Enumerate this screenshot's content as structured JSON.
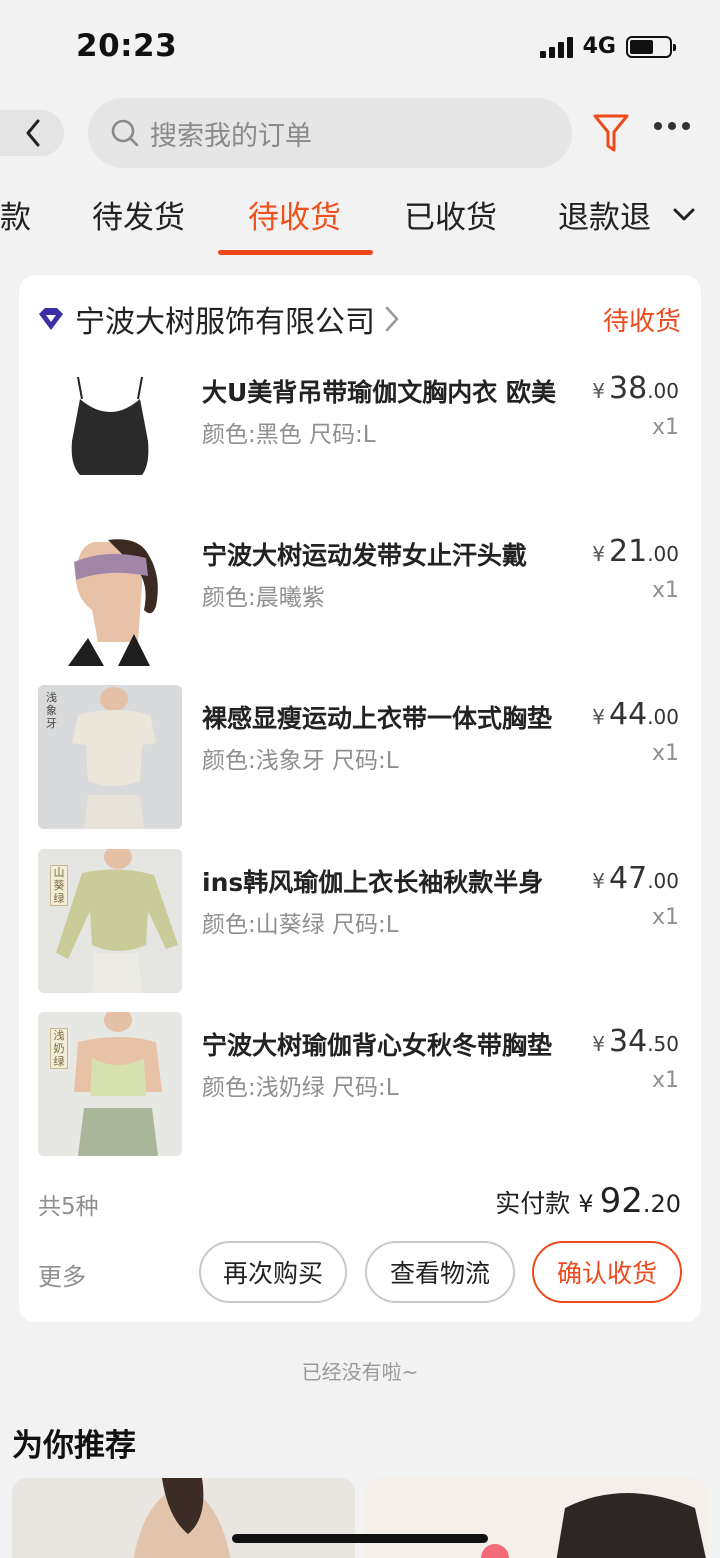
{
  "status_bar": {
    "time": "20:23",
    "network": "4G",
    "battery_level": 0.6
  },
  "search": {
    "placeholder": "搜索我的订单"
  },
  "tabs": [
    {
      "label": "款",
      "active": false
    },
    {
      "label": "待发货",
      "active": false
    },
    {
      "label": "待收货",
      "active": true
    },
    {
      "label": "已收货",
      "active": false
    },
    {
      "label": "退款退",
      "active": false
    }
  ],
  "order": {
    "shop_name": "宁波大树服饰有限公司",
    "status": "待收货",
    "items": [
      {
        "title": "大U美背吊带瑜伽文胸内衣 欧美",
        "spec": "颜色:黑色 尺码:L",
        "price_int": "38",
        "price_dec": ".00",
        "qty": "x1"
      },
      {
        "title": "宁波大树运动发带女止汗头戴",
        "spec": "颜色:晨曦紫",
        "price_int": "21",
        "price_dec": ".00",
        "qty": "x1"
      },
      {
        "title": "裸感显瘦运动上衣带一体式胸垫",
        "spec": "颜色:浅象牙 尺码:L",
        "price_int": "44",
        "price_dec": ".00",
        "qty": "x1",
        "img_label": "浅象牙"
      },
      {
        "title": "ins韩风瑜伽上衣长袖秋款半身",
        "spec": "颜色:山葵绿 尺码:L",
        "price_int": "47",
        "price_dec": ".00",
        "qty": "x1",
        "img_label": "山葵绿"
      },
      {
        "title": "宁波大树瑜伽背心女秋冬带胸垫",
        "spec": "颜色:浅奶绿 尺码:L",
        "price_int": "34",
        "price_dec": ".50",
        "qty": "x1",
        "img_label": "浅奶绿"
      }
    ],
    "currency": "¥",
    "count_text": "共5种",
    "paid_label": "实付款",
    "paid_int": "92",
    "paid_dec": ".20",
    "more": "更多",
    "buttons": {
      "rebuy": "再次购买",
      "logistics": "查看物流",
      "confirm": "确认收货"
    }
  },
  "end_text": "已经没有啦~",
  "recommend_title": "为你推荐",
  "colors": {
    "accent": "#ee4a1b",
    "background": "#f2f2f2"
  }
}
